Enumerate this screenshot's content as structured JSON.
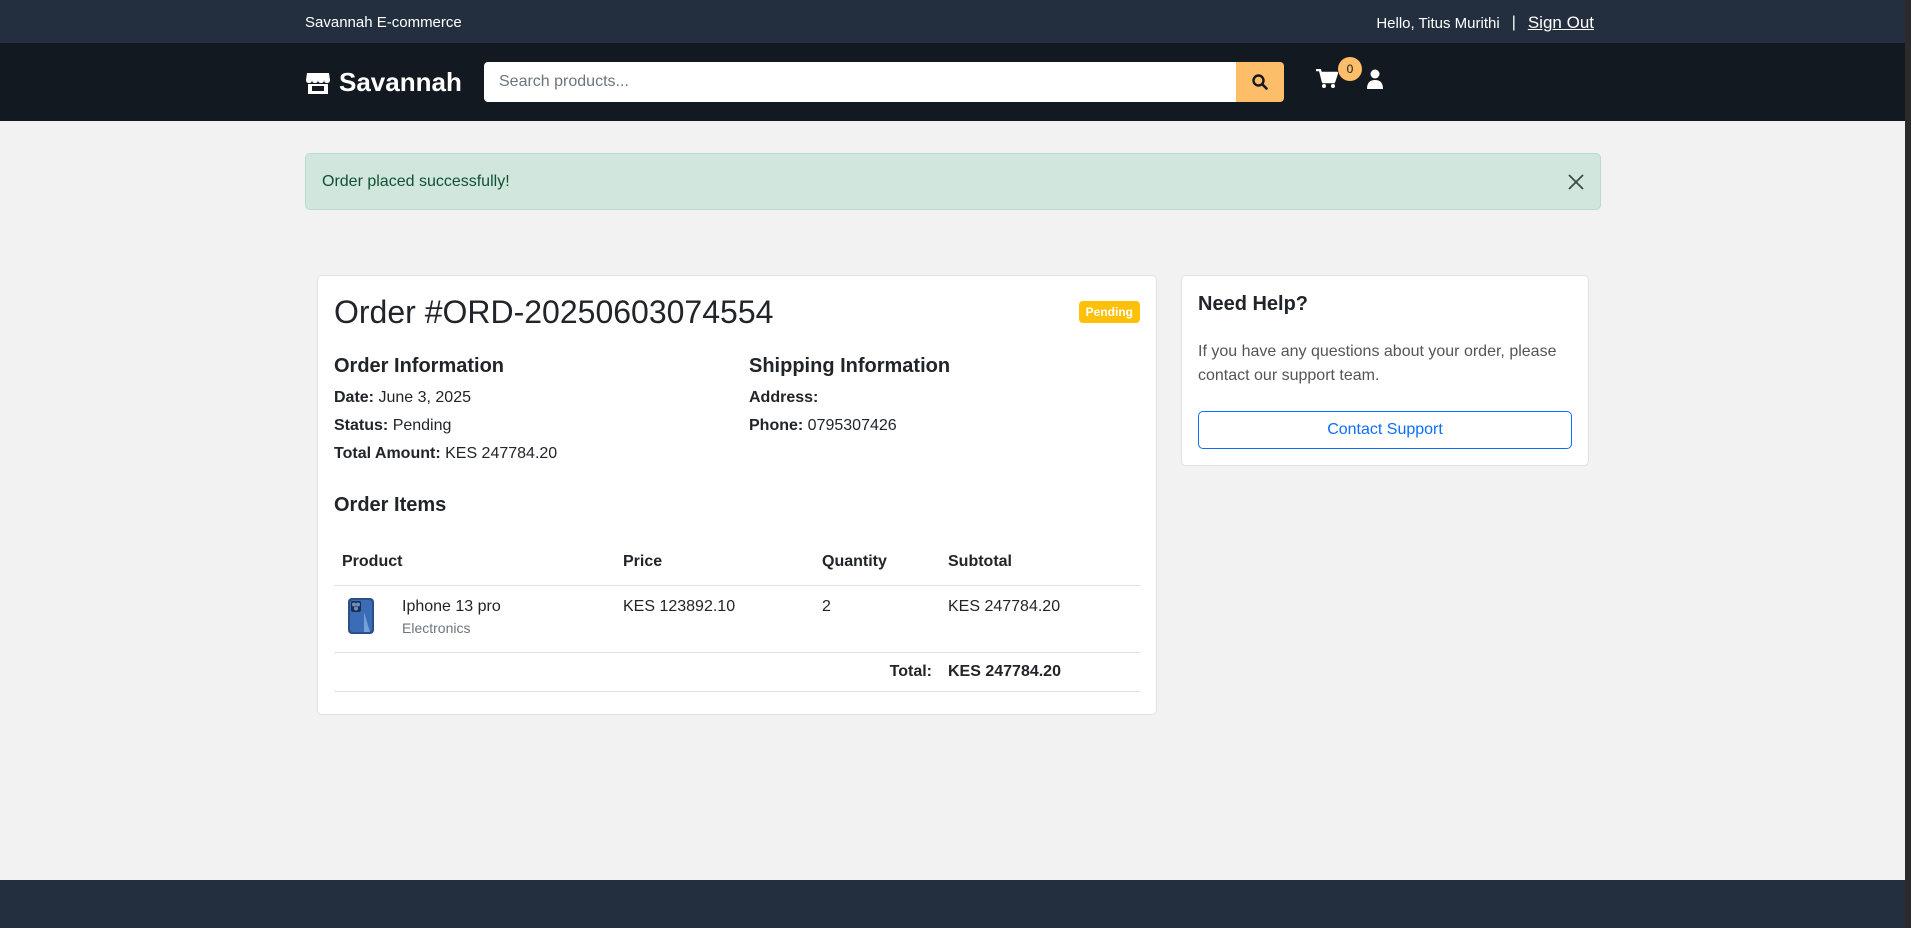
{
  "topbar": {
    "brand": "Savannah E-commerce",
    "greeting": "Hello, Titus Murithi",
    "separator": "|",
    "sign_out": "Sign Out"
  },
  "navbar": {
    "logo": "Savannah",
    "logo_icon": "store-icon",
    "search_placeholder": "Search products...",
    "cart_count": "0"
  },
  "alert": {
    "message": "Order placed successfully!"
  },
  "order": {
    "title": "Order #ORD-20250603074554",
    "status_badge": "Pending",
    "info_heading": "Order Information",
    "date_label": "Date:",
    "date_value": "June 3, 2025",
    "status_label": "Status:",
    "status_value": "Pending",
    "total_label": "Total Amount:",
    "total_value": "KES 247784.20",
    "shipping_heading": "Shipping Information",
    "address_label": "Address:",
    "address_value": "",
    "phone_label": "Phone:",
    "phone_value": "0795307426",
    "items_heading": "Order Items",
    "columns": [
      "Product",
      "Price",
      "Quantity",
      "Subtotal"
    ],
    "items": [
      {
        "name": "Iphone 13 pro",
        "category": "Electronics",
        "price": "KES 123892.10",
        "quantity": "2",
        "subtotal": "KES 247784.20"
      }
    ],
    "total_row_label": "Total:",
    "total_row_value": "KES 247784.20"
  },
  "help": {
    "title": "Need Help?",
    "text": "If you have any questions about your order, please contact our support team.",
    "button": "Contact Support"
  },
  "colors": {
    "topbar": "#232f3e",
    "navbar": "#131921",
    "accent": "#febd69",
    "badge": "#ffc107",
    "alert_bg": "#d1e7dd",
    "link": "#0d6efd"
  }
}
